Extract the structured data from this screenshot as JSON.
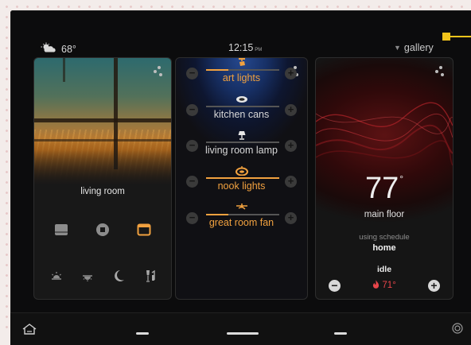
{
  "status": {
    "weather_icon": "partly-cloudy-icon",
    "temperature": "68°",
    "time": "12:15",
    "ampm": "PM",
    "gallery_label": "gallery"
  },
  "living_room": {
    "title": "living room",
    "controls_row1": [
      "shade-down-icon",
      "stop-icon",
      "shade-up-icon"
    ],
    "controls_row2": [
      "sunrise-icon",
      "sunset-icon",
      "moon-icon",
      "wine-icon"
    ]
  },
  "lights": [
    {
      "label": "art lights",
      "icon": "spotlight-icon",
      "level": 0.3,
      "on": true
    },
    {
      "label": "kitchen cans",
      "icon": "can-light-icon",
      "level": 0,
      "on": false
    },
    {
      "label": "living room lamp",
      "icon": "lamp-icon",
      "level": 0,
      "on": false
    },
    {
      "label": "nook lights",
      "icon": "pendant-icon",
      "level": 1.0,
      "on": true
    },
    {
      "label": "great room fan",
      "icon": "fan-icon",
      "level": 0.3,
      "on": true
    }
  ],
  "thermostat": {
    "temperature": "77",
    "degree": "°",
    "zone": "main floor",
    "schedule_label": "using schedule",
    "schedule": "home",
    "state": "idle",
    "setpoint": "71°"
  },
  "colors": {
    "accent": "#f1a13f",
    "heat": "#e8454a",
    "annotation": "#f2c41b"
  }
}
